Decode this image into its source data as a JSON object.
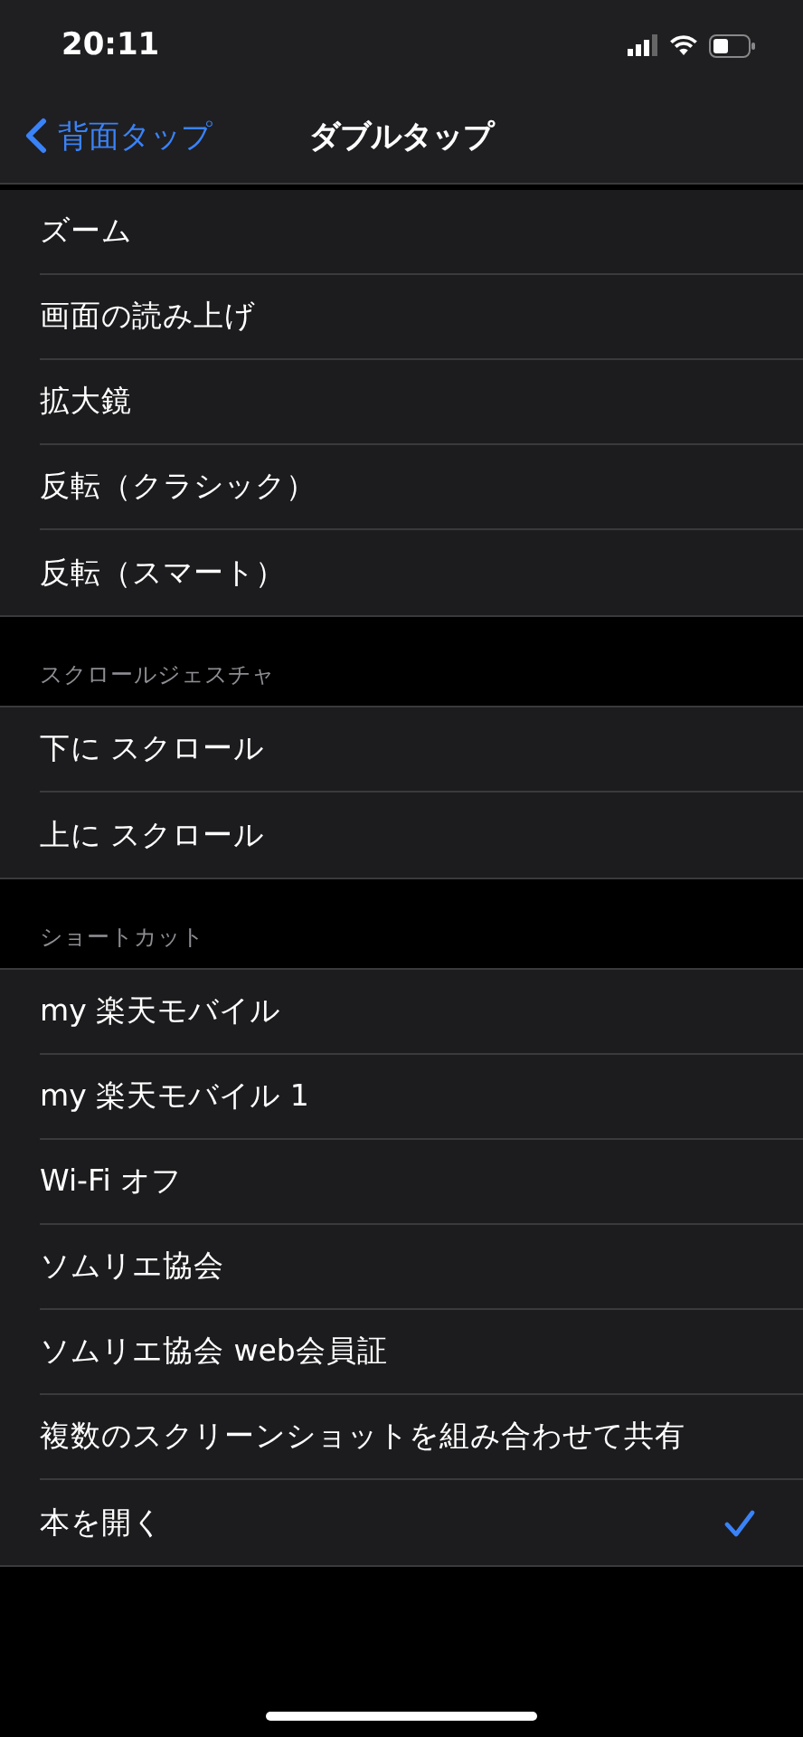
{
  "status_bar": {
    "time": "20:11"
  },
  "nav": {
    "back": "背面タップ",
    "title": "ダブルタップ"
  },
  "sections": [
    {
      "items": [
        {
          "label": "ズーム",
          "selected": false
        },
        {
          "label": "画面の読み上げ",
          "selected": false
        },
        {
          "label": "拡大鏡",
          "selected": false
        },
        {
          "label": "反転（クラシック）",
          "selected": false
        },
        {
          "label": "反転（スマート）",
          "selected": false
        }
      ]
    },
    {
      "header": "スクロールジェスチャ",
      "items": [
        {
          "label": "下に スクロール",
          "selected": false
        },
        {
          "label": "上に スクロール",
          "selected": false
        }
      ]
    },
    {
      "header": "ショートカット",
      "items": [
        {
          "label": "my 楽天モバイル",
          "selected": false
        },
        {
          "label": "my 楽天モバイル 1",
          "selected": false
        },
        {
          "label": "Wi-Fi オフ",
          "selected": false
        },
        {
          "label": "ソムリエ協会",
          "selected": false
        },
        {
          "label": "ソムリエ協会 web会員証",
          "selected": false
        },
        {
          "label": "複数のスクリーンショットを組み合わせて共有",
          "selected": false
        },
        {
          "label": "本を開く",
          "selected": true
        }
      ]
    }
  ]
}
